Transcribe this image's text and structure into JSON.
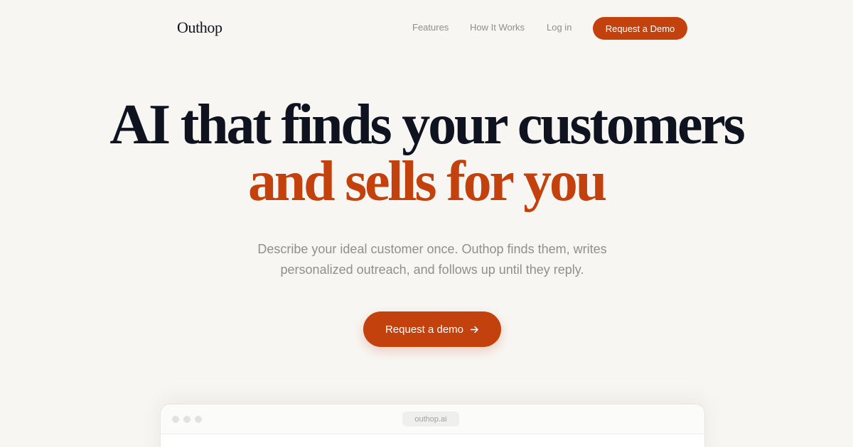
{
  "brand": {
    "name": "Outhop",
    "accent_color": "#c2410c"
  },
  "nav": {
    "links": [
      "Features",
      "How It Works",
      "Log in"
    ],
    "cta_label": "Request a Demo"
  },
  "hero": {
    "headline_line1": "AI that finds your customers",
    "headline_line2": "and sells for you",
    "subtext": "Describe your ideal customer once. Outhop finds them, writes personalized outreach, and follows up until they reply.",
    "cta_label": "Request a demo",
    "cta_icon": "arrow-right-icon"
  },
  "preview": {
    "url": "outhop.ai"
  }
}
